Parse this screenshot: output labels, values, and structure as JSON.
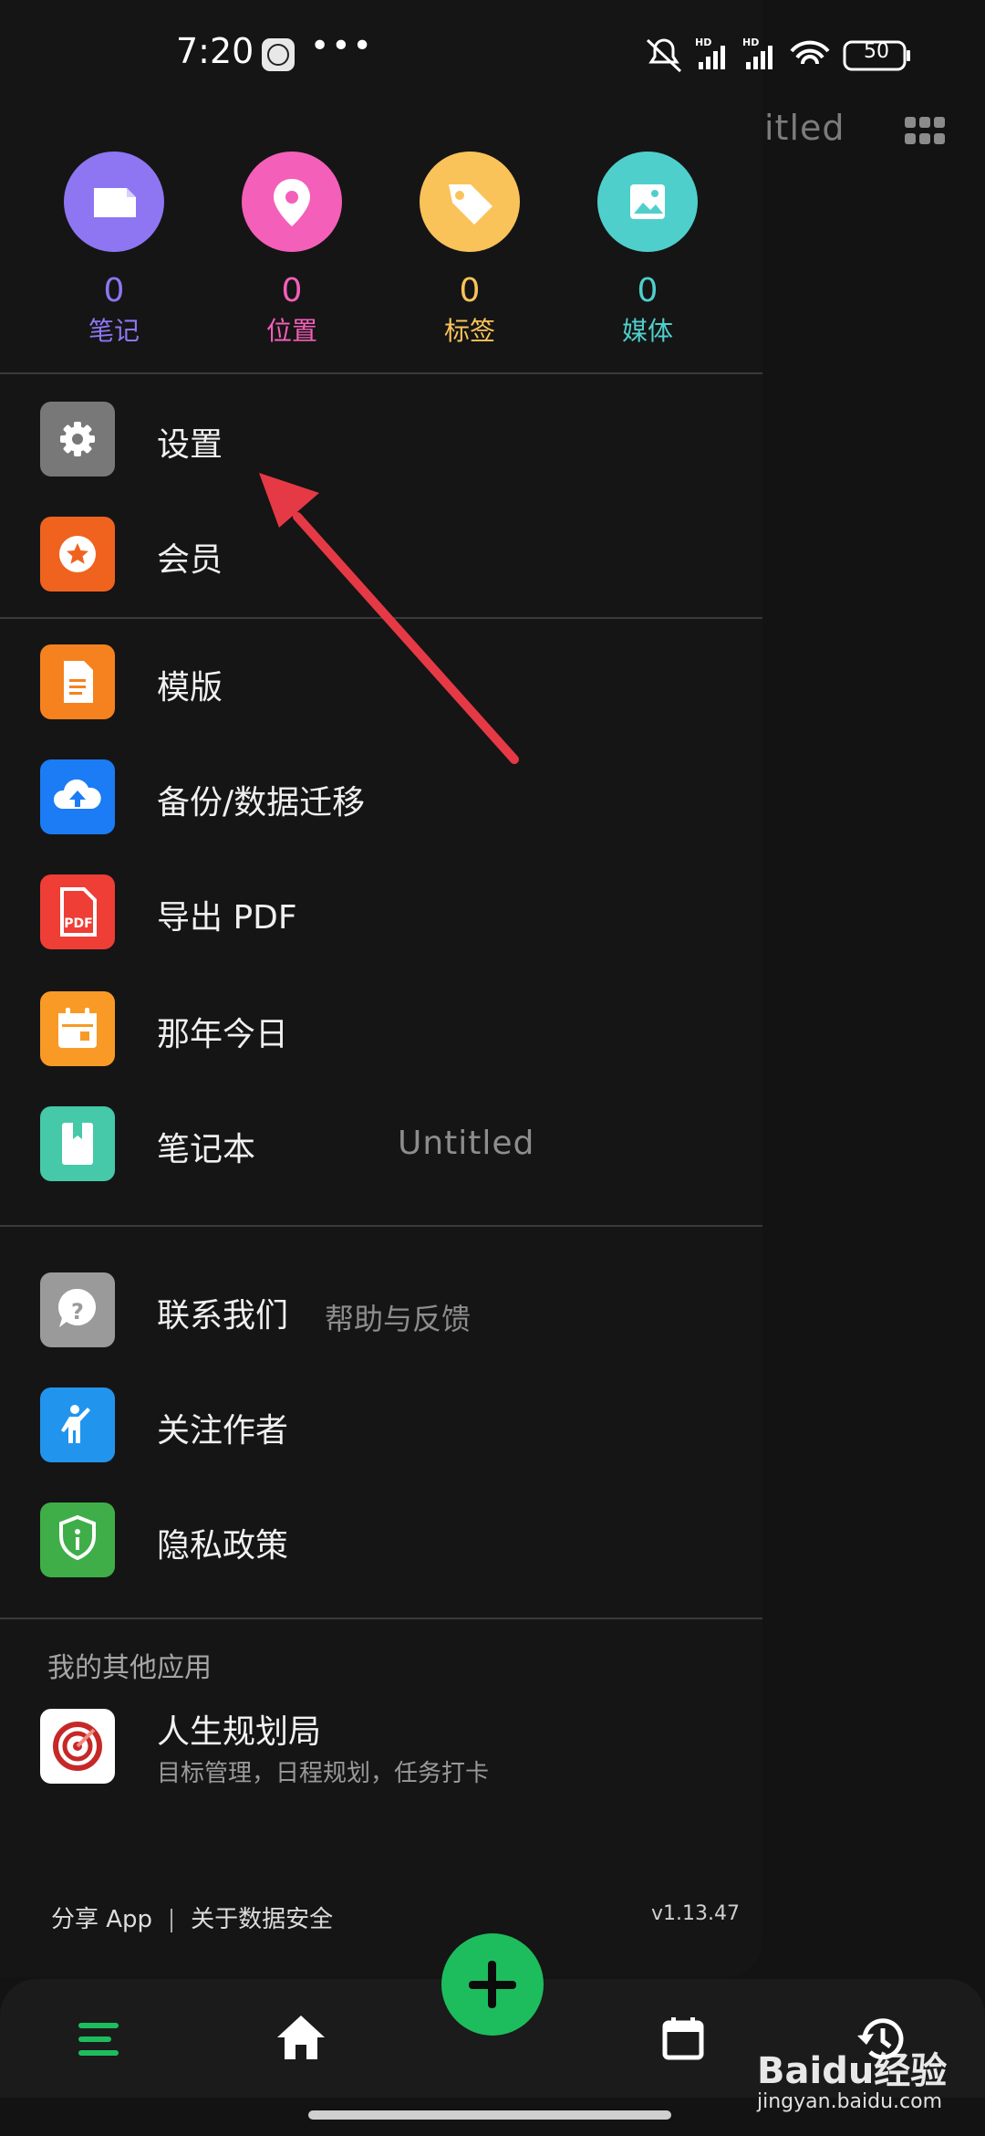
{
  "status_bar": {
    "time": "7:20",
    "dots": "•••",
    "battery": "50"
  },
  "background_header": {
    "title_fragment": "itled"
  },
  "stats": [
    {
      "count": "0",
      "label": "笔记",
      "color": "#8e76f3"
    },
    {
      "count": "0",
      "label": "位置",
      "color": "#f45fb9"
    },
    {
      "count": "0",
      "label": "标签",
      "color": "#f9c35a"
    },
    {
      "count": "0",
      "label": "媒体",
      "color": "#4fcfcc"
    }
  ],
  "menu": {
    "settings": "设置",
    "member": "会员",
    "template": "模版",
    "backup": "备份/数据迁移",
    "export_pdf": "导出 PDF",
    "on_this_day": "那年今日",
    "notebook": "笔记本",
    "notebook_value": "Untitled",
    "contact": "联系我们",
    "contact_sub": "帮助与反馈",
    "follow": "关注作者",
    "privacy": "隐私政策"
  },
  "other_apps": {
    "title": "我的其他应用",
    "app_name": "人生规划局",
    "app_desc": "目标管理，日程规划，任务打卡"
  },
  "footer": {
    "share": "分享 App",
    "data_security": "关于数据安全",
    "version": "v1.13.47"
  },
  "watermark": {
    "brand": "Baidu经验",
    "url": "jingyan.baidu.com"
  },
  "icon_colors": {
    "settings": "#787878",
    "member": "#f0631e",
    "template": "#f5821f",
    "backup": "#1b7cf5",
    "export_pdf": "#ee3e36",
    "on_this_day": "#f99a26",
    "notebook": "#45c9a9",
    "contact": "#9a9a9a",
    "follow": "#2194ee",
    "privacy": "#3fae48",
    "fab": "#1dbd5e",
    "arrow": "#e63946"
  }
}
